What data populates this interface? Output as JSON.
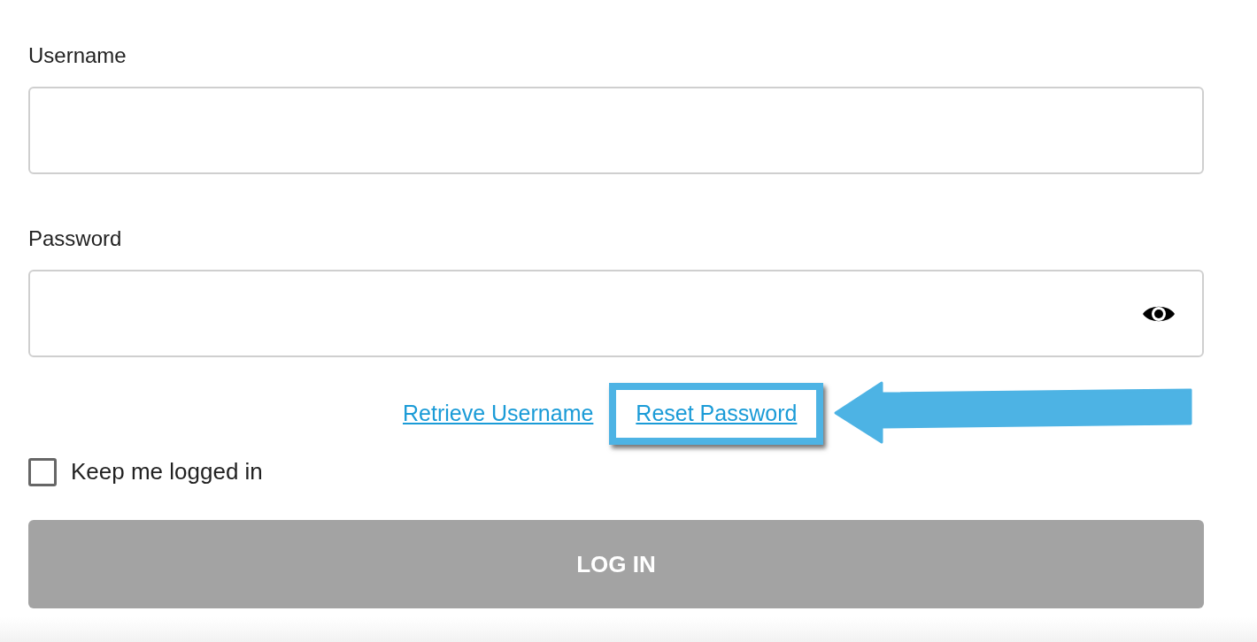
{
  "fields": [
    {
      "label": "Username",
      "kind": "text"
    },
    {
      "label": "Password",
      "kind": "password"
    }
  ],
  "links": [
    {
      "label": "Retrieve Username",
      "highlighted": false
    },
    {
      "label": "Reset Password",
      "highlighted": true
    }
  ],
  "remember": {
    "label": "Keep me logged in",
    "checked": false
  },
  "login_button": {
    "label": "LOG IN",
    "disabled": true
  }
}
